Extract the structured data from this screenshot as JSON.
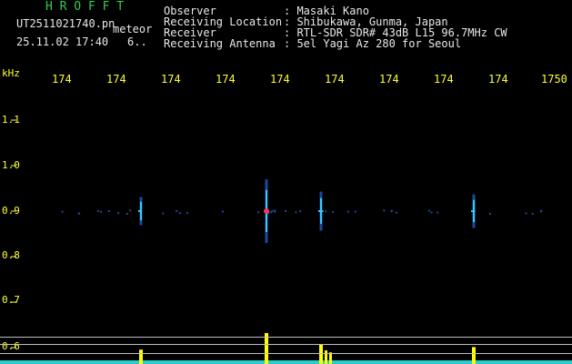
{
  "header": {
    "station": "H R O F F T",
    "filename": "UT2511021740.pn",
    "mode": "meteor",
    "datetime": "25.11.02 17:40",
    "counter": "6.."
  },
  "info": {
    "rows": [
      {
        "label": "Observer",
        "value": ": Masaki Kano"
      },
      {
        "label": "Receiving Location",
        "value": ": Shibukawa, Gunma, Japan"
      },
      {
        "label": "Receiver",
        "value": ": RTL-SDR SDR# 43dB L15 96.7MHz CW"
      },
      {
        "label": "Receiving Antenna",
        "value": ": 5el Yagi Az 280 for Seoul"
      }
    ]
  },
  "axis": {
    "unit": "kHz",
    "x_ticks": [
      "174",
      "174",
      "174",
      "174",
      "174",
      "174",
      "174",
      "174",
      "174",
      "1750"
    ],
    "y_ticks": [
      "1.1",
      "1.0",
      "0.9",
      "0.8",
      "0.7",
      "0.6"
    ]
  },
  "colors": {
    "background": "#000000",
    "label": "#ffff33",
    "title": "#33cc55",
    "text": "#e8e8e8",
    "signal_core": "#ff3355",
    "signal_mid": "#33ccff",
    "signal_faint": "#1a4a9a",
    "spectrum": "#ffff00",
    "baseline": "#33ffff"
  },
  "signals": [
    {
      "time": 1742.5,
      "freq": 0.9,
      "strength": 0.35
    },
    {
      "time": 1744.8,
      "freq": 0.9,
      "strength": 1.0
    },
    {
      "time": 1745.8,
      "freq": 0.9,
      "strength": 0.55
    },
    {
      "time": 1748.6,
      "freq": 0.9,
      "strength": 0.45
    }
  ]
}
